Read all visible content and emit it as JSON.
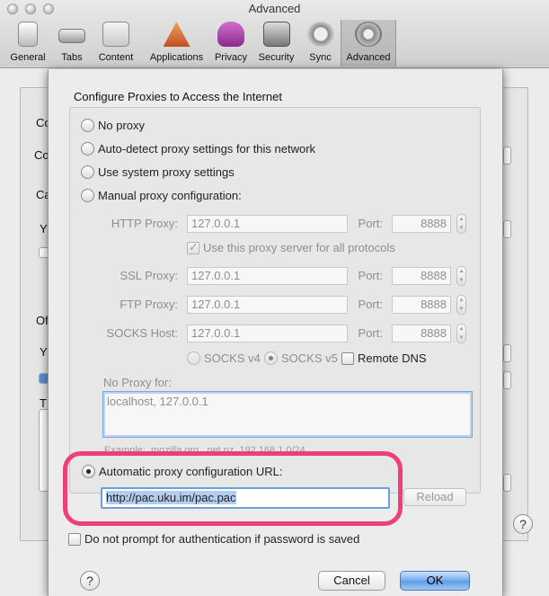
{
  "window": {
    "title": "Advanced"
  },
  "toolbar": {
    "items": [
      {
        "label": "General",
        "icon": "general-icon"
      },
      {
        "label": "Tabs",
        "icon": "tabs-icon"
      },
      {
        "label": "Content",
        "icon": "content-icon"
      },
      {
        "label": "Applications",
        "icon": "applications-icon"
      },
      {
        "label": "Privacy",
        "icon": "privacy-icon"
      },
      {
        "label": "Security",
        "icon": "security-icon"
      },
      {
        "label": "Sync",
        "icon": "sync-icon"
      },
      {
        "label": "Advanced",
        "icon": "advanced-icon",
        "selected": true
      }
    ]
  },
  "background": {
    "fragments": [
      "Co",
      "Co",
      "Ca",
      "Y",
      "Of",
      "Y",
      "T"
    ],
    "help": "?"
  },
  "sheet": {
    "heading": "Configure Proxies to Access the Internet",
    "options": {
      "no_proxy": "No proxy",
      "auto_detect": "Auto-detect proxy settings for this network",
      "system": "Use system proxy settings",
      "manual": "Manual proxy configuration:",
      "auto_url": "Automatic proxy configuration URL:"
    },
    "selected_option": "auto_url",
    "http": {
      "label": "HTTP Proxy:",
      "host": "127.0.0.1",
      "port_label": "Port:",
      "port": "8888"
    },
    "same_for_all": {
      "label": "Use this proxy server for all protocols",
      "checked": true
    },
    "ssl": {
      "label": "SSL Proxy:",
      "host": "127.0.0.1",
      "port_label": "Port:",
      "port": "8888"
    },
    "ftp": {
      "label": "FTP Proxy:",
      "host": "127.0.0.1",
      "port_label": "Port:",
      "port": "8888"
    },
    "socks": {
      "label": "SOCKS Host:",
      "host": "127.0.0.1",
      "port_label": "Port:",
      "port": "8888"
    },
    "socks_v4": "SOCKS v4",
    "socks_v5": "SOCKS v5",
    "remote_dns": {
      "label": "Remote DNS",
      "checked": false
    },
    "no_proxy_for": {
      "label": "No Proxy for:",
      "value": "localhost, 127.0.0.1"
    },
    "example": "Example: .mozilla.org, .net.nz, 192.168.1.0/24",
    "pac_url": "http://pac.uku.im/pac.pac",
    "reload": "Reload",
    "do_not_prompt": {
      "label": "Do not prompt for authentication if password is saved",
      "checked": false
    },
    "help": "?",
    "cancel": "Cancel",
    "ok": "OK"
  },
  "colors": {
    "highlight": "#ef3f7a",
    "ok_button": "#5e9ae6",
    "focus": "#6e9fdd"
  }
}
